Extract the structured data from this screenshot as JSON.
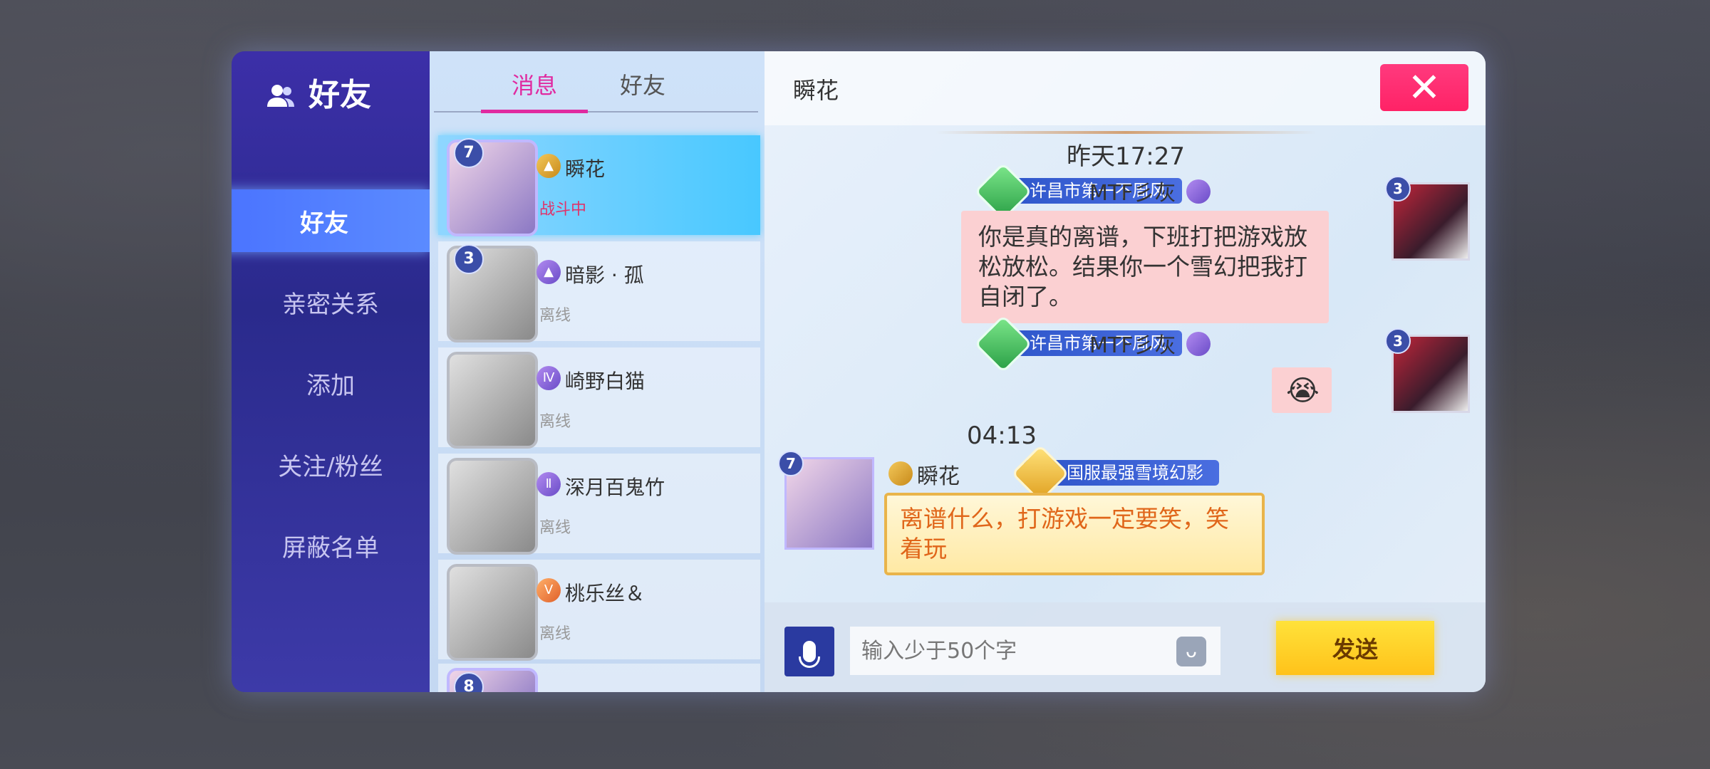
{
  "sidebar": {
    "title": "好友",
    "items": [
      {
        "label": "好友",
        "active": true
      },
      {
        "label": "亲密关系"
      },
      {
        "label": "添加"
      },
      {
        "label": "关注/粉丝"
      },
      {
        "label": "屏蔽名单"
      }
    ]
  },
  "list": {
    "tabs": [
      {
        "label": "消息",
        "active": true
      },
      {
        "label": "好友"
      }
    ],
    "friends": [
      {
        "name": "瞬花",
        "status": "战斗中",
        "level": "7"
      },
      {
        "name": "暗影 · 孤",
        "status": "离线",
        "level": "3"
      },
      {
        "name": "崎野白猫",
        "status": "离线"
      },
      {
        "name": "深月百鬼竹",
        "status": "离线"
      },
      {
        "name": "桃乐丝＆",
        "status": "离线"
      },
      {
        "level": "8"
      }
    ]
  },
  "chat": {
    "title": "瞬花",
    "close_label": "✕",
    "messages": [
      {
        "time": "昨天17:27"
      },
      {
        "sender": "MTF彡灰",
        "badge": "许昌市第一不周风",
        "level": "3",
        "text": "你是真的离谱，下班打把游戏放松放松。结果你一个雪幻把我打自闭了。"
      },
      {
        "sender": "MTF彡灰",
        "badge": "许昌市第一不周风",
        "level": "3",
        "text": "😭"
      },
      {
        "time": "04:13"
      },
      {
        "sender": "瞬花",
        "badge": "国服最强雪境幻影",
        "level": "7",
        "text": "离谱什么，打游戏一定要笑，笑着玩"
      }
    ],
    "input_placeholder": "输入少于50个字",
    "send_label": "发送"
  }
}
